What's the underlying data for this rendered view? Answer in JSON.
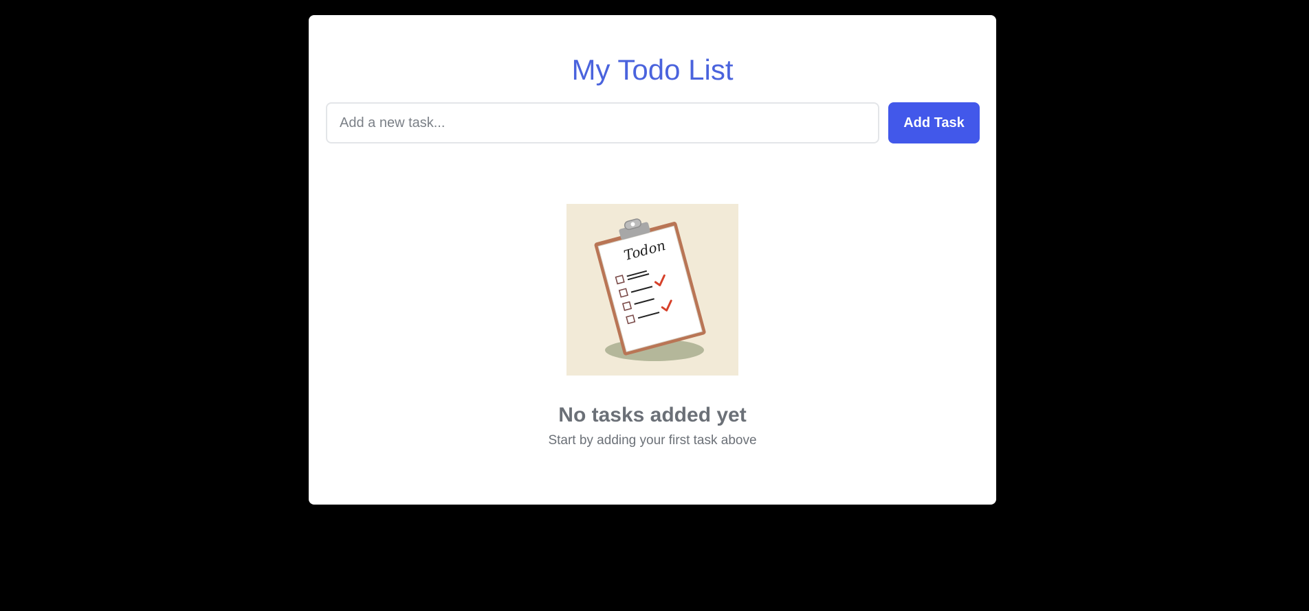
{
  "header": {
    "title": "My Todo List"
  },
  "task_form": {
    "input_placeholder": "Add a new task...",
    "input_value": "",
    "add_button_label": "Add Task"
  },
  "empty_state": {
    "illustration_icon": "clipboard-checklist-icon",
    "illustration_text": "Todon",
    "title": "No tasks added yet",
    "subtitle": "Start by adding your first task above"
  },
  "colors": {
    "page_background": "#000000",
    "card_background": "#ffffff",
    "accent": "#4258ea",
    "title_color": "#4a63dd",
    "muted_text": "#6b7077"
  }
}
